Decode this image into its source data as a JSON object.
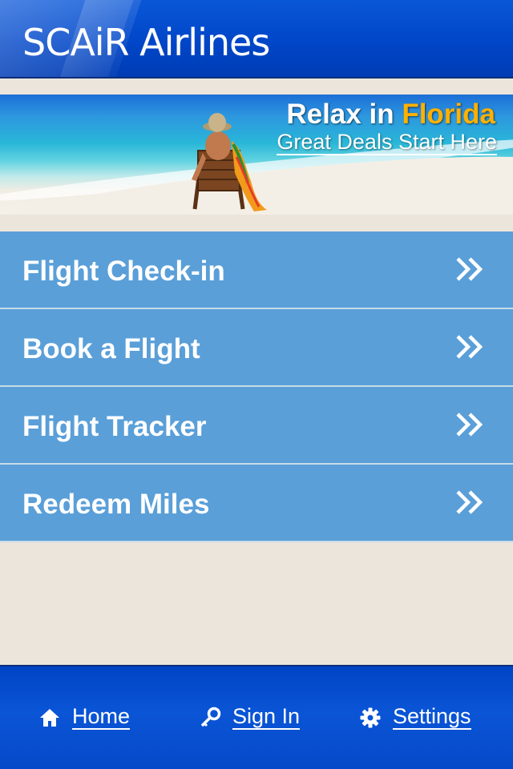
{
  "app": {
    "title": "SCAiR Airlines"
  },
  "banner": {
    "headline_prefix": "Relax in",
    "headline_highlight": "Florida",
    "subline": "Great Deals Start Here",
    "highlight_color": "#ffb000"
  },
  "menu": {
    "items": [
      {
        "label": "Flight Check-in",
        "icon": "double-chevron-right-icon"
      },
      {
        "label": "Book a Flight",
        "icon": "double-chevron-right-icon"
      },
      {
        "label": "Flight Tracker",
        "icon": "double-chevron-right-icon"
      },
      {
        "label": "Redeem Miles",
        "icon": "double-chevron-right-icon"
      }
    ]
  },
  "footer": {
    "home": {
      "label": "Home",
      "icon": "home-icon"
    },
    "signin": {
      "label": "Sign In",
      "icon": "key-icon"
    },
    "settings": {
      "label": "Settings",
      "icon": "gear-icon"
    }
  },
  "colors": {
    "header_blue": "#0046c8",
    "menu_blue": "#5a9fd8",
    "page_bg": "#ebe5dc"
  }
}
